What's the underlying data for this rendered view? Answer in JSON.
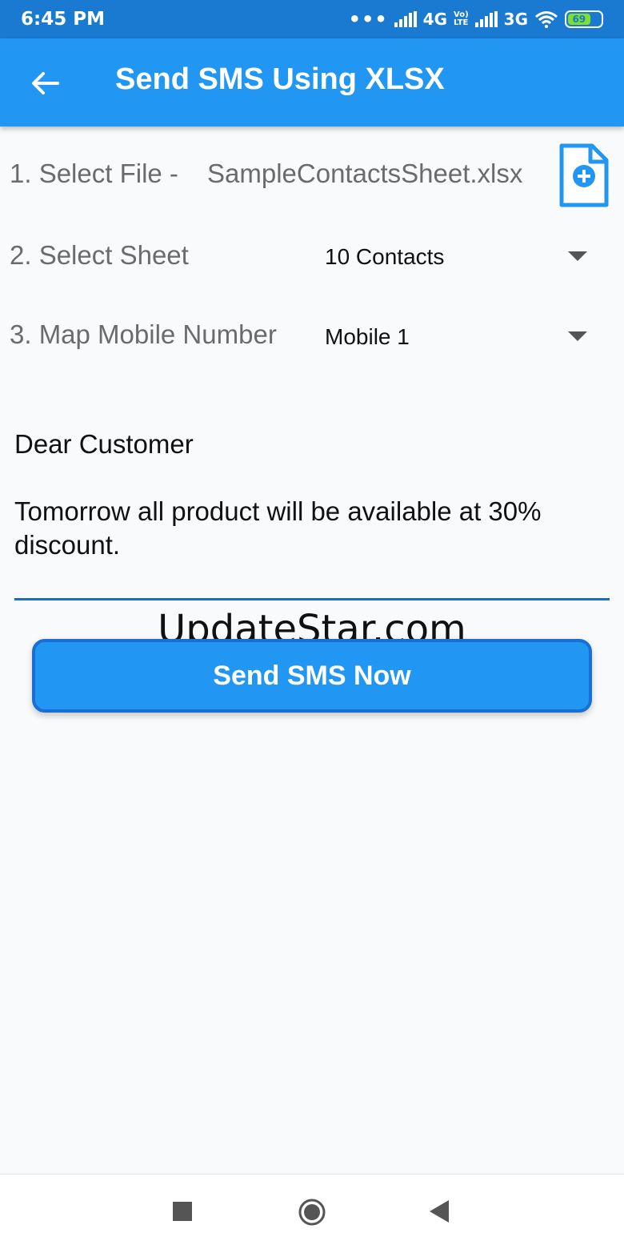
{
  "status_bar": {
    "time": "6:45 PM",
    "network_primary": "4G",
    "volte_top": "Vo)",
    "volte_bottom": "LTE",
    "network_secondary": "3G",
    "battery_level": "69"
  },
  "app_bar": {
    "title": "Send SMS Using XLSX"
  },
  "form": {
    "select_file_label": "1. Select File  -",
    "file_name": "SampleContactsSheet.xlsx",
    "select_sheet_label": "2. Select Sheet",
    "select_sheet_value": "10 Contacts",
    "map_mobile_label": "3. Map Mobile Number",
    "map_mobile_value": "Mobile 1"
  },
  "message": {
    "text": "Dear Customer\n\nTomorrow all product will be available at 30% discount."
  },
  "watermark": "UpdateStar.com",
  "send_button_label": "Send SMS Now",
  "colors": {
    "status_bar": "#1a7ad2",
    "app_bar": "#2196f3",
    "accent": "#1e6bc0",
    "label": "#6b6b6b"
  }
}
